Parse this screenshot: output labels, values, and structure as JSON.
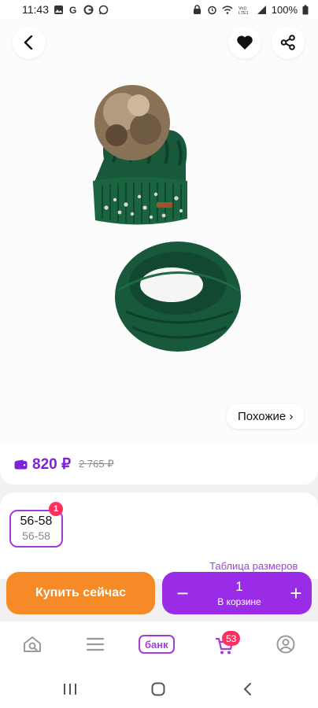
{
  "status_bar": {
    "time": "11:43",
    "notification_icons": [
      "image-icon",
      "g-letter-icon",
      "google-icon",
      "whatsapp-icon"
    ],
    "right_icons": [
      "lock-icon",
      "alarm-icon",
      "wifi-icon",
      "volte-lte-icon",
      "signal-icon"
    ],
    "battery": "100%"
  },
  "product": {
    "image_description_icons": [
      "back-icon",
      "heart-icon",
      "share-icon"
    ],
    "similar_label": "Похожие ›"
  },
  "price": {
    "current": "820 ₽",
    "old": "2 765 ₽",
    "accent": "#7d22d8"
  },
  "sizes": {
    "selected_main": "56-58",
    "selected_sub": "56-58",
    "badge": "1",
    "table_link": "Таблица размеров"
  },
  "actions": {
    "buy_now": "Купить сейчас",
    "quantity": "1",
    "in_cart": "В корзине",
    "minus": "−",
    "plus": "+",
    "buy_color": "#f58a27",
    "cart_color": "#9a2be6"
  },
  "bottom_nav": {
    "bank_label": "банк",
    "cart_badge": "53",
    "items": [
      "home-search-icon",
      "catalog-icon",
      "bank-button",
      "cart-icon",
      "profile-icon"
    ]
  },
  "system_nav": {
    "items": [
      "recent-apps-icon",
      "home-icon",
      "back-icon"
    ]
  }
}
